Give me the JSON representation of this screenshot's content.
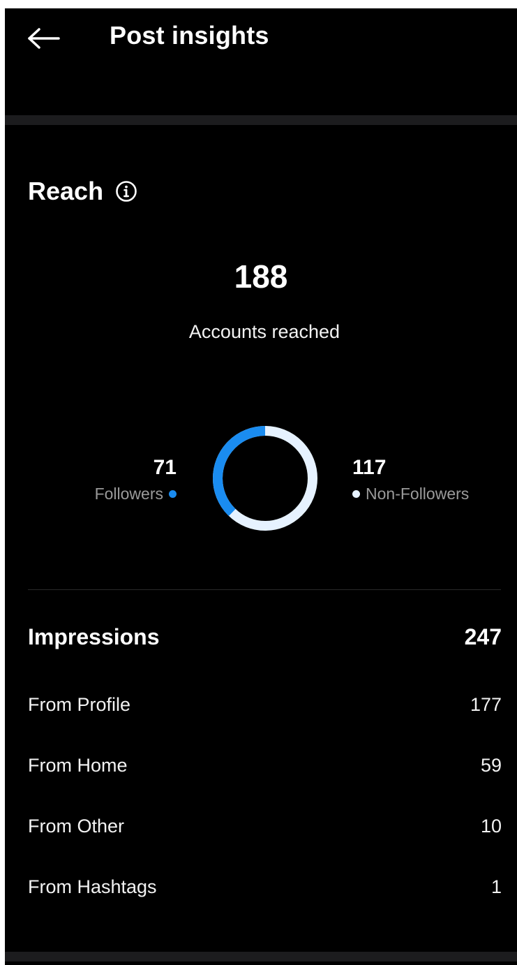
{
  "header": {
    "title": "Post insights",
    "back_icon": "arrow-left-icon"
  },
  "reach": {
    "title": "Reach",
    "info_icon": "info-icon",
    "accounts_reached": "188",
    "accounts_reached_label": "Accounts reached",
    "followers": {
      "value": "71",
      "label": "Followers",
      "color": "#1a8cf0"
    },
    "non_followers": {
      "value": "117",
      "label": "Non-Followers",
      "color": "#e6f2ff"
    }
  },
  "impressions": {
    "title": "Impressions",
    "total": "247",
    "sources": [
      {
        "label": "From Profile",
        "value": "177"
      },
      {
        "label": "From Home",
        "value": "59"
      },
      {
        "label": "From Other",
        "value": "10"
      },
      {
        "label": "From Hashtags",
        "value": "1"
      }
    ]
  },
  "colors": {
    "background": "#000000",
    "accent": "#1a8cf0",
    "secondary_ring": "#e6f2ff",
    "muted_text": "#9a9a9a"
  }
}
